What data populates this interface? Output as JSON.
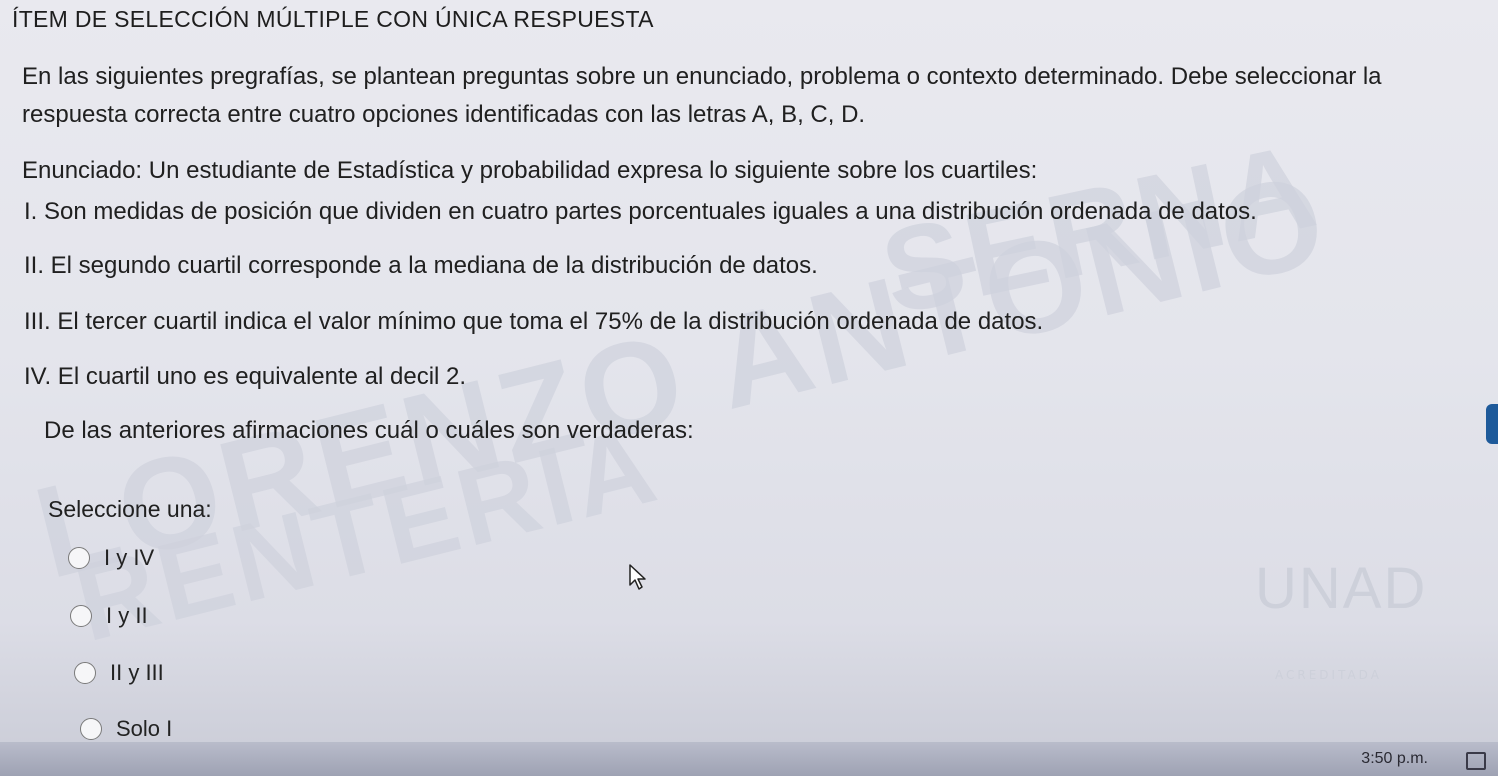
{
  "header": {
    "title": "ÍTEM DE SELECCIÓN MÚLTIPLE CON ÚNICA RESPUESTA"
  },
  "instructions": "En las siguientes pregrafías, se plantean preguntas sobre un enunciado, problema o contexto determinado. Debe seleccionar la respuesta correcta entre cuatro opciones identificadas con las letras A, B, C, D.",
  "enunciado": "Enunciado: Un estudiante de Estadística y probabilidad expresa lo siguiente sobre los cuartiles:",
  "statements": [
    "I. Son medidas de posición que dividen en cuatro partes porcentuales iguales a una distribución ordenada de datos.",
    "II. El segundo cuartil corresponde a la mediana de la distribución de datos.",
    "III. El tercer cuartil indica el valor mínimo que toma el 75% de la distribución ordenada de datos.",
    "IV. El cuartil uno es equivalente al decil 2."
  ],
  "question": "De las anteriores afirmaciones cuál o cuáles son verdaderas:",
  "answer": {
    "prompt": "Seleccione una:",
    "options": [
      "I y IV",
      "I y II",
      "II y III",
      "Solo I"
    ],
    "selected": null
  },
  "watermark": {
    "lines": [
      "SERNA",
      "LORENZO ANTONIO",
      "RENTERIA"
    ],
    "logo": "UNAD",
    "logo_sub": "ACREDITADA"
  },
  "taskbar": {
    "clock": "3:50 p.m."
  },
  "icons": {
    "cursor": "mouse-pointer-icon",
    "notifications": "notification-icon"
  }
}
